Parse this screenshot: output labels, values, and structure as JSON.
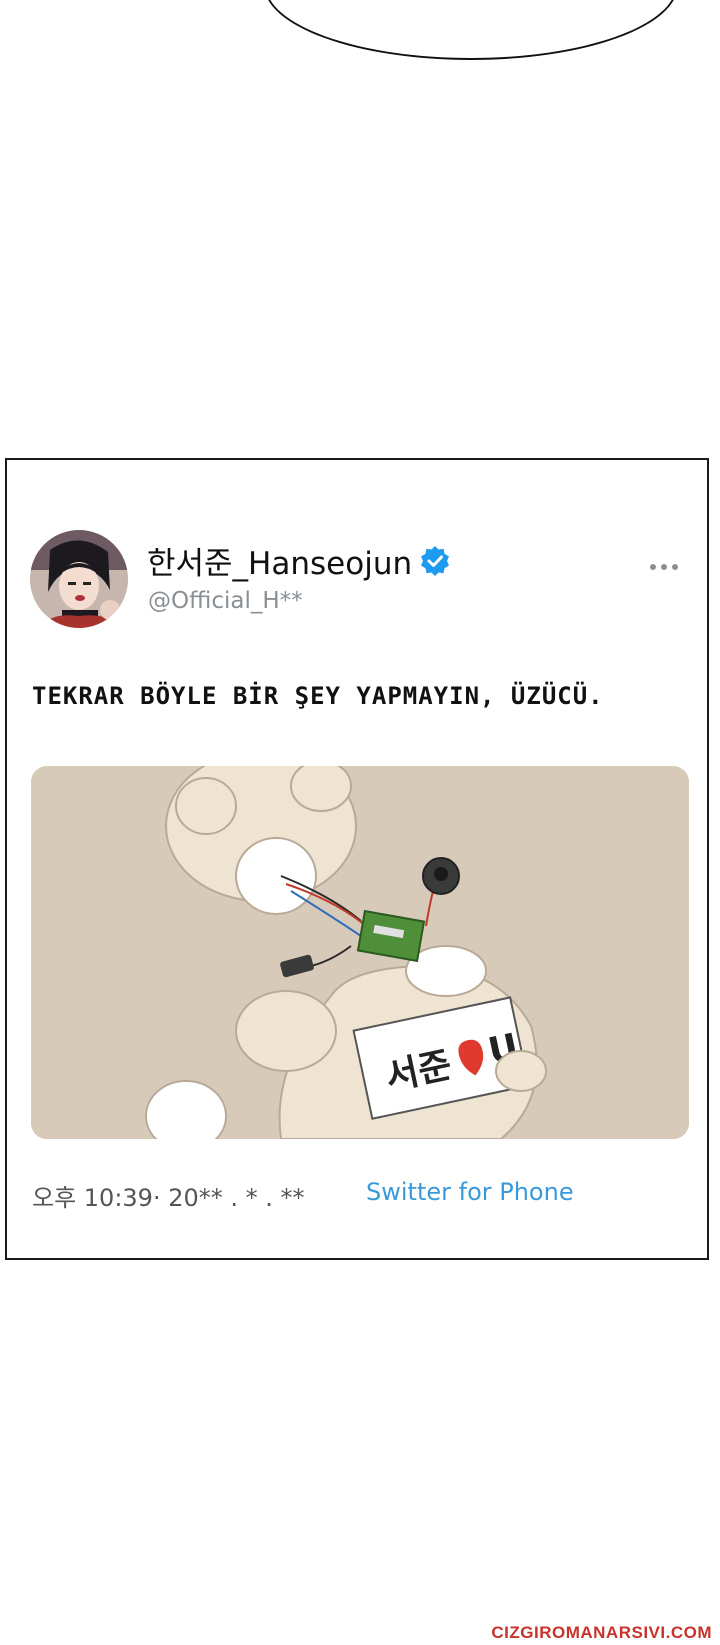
{
  "tweet": {
    "display_name": "한서준_Hanseojun",
    "handle": "@Official_H**",
    "text": "TEKRAR BÖYLE BİR ŞEY YAPMAYIN, ÜZÜCÜ.",
    "timestamp": "오후 10:39·   20** . * . **",
    "source": "Switter for Phone",
    "verified_color": "#1d9bf0"
  },
  "media": {
    "sign_text": "서준",
    "sign_suffix": "U"
  },
  "watermark": "CIZGIROMANARSIVI.COM",
  "icons": {
    "verified": "verified-badge-icon",
    "more": "more-options-icon"
  }
}
